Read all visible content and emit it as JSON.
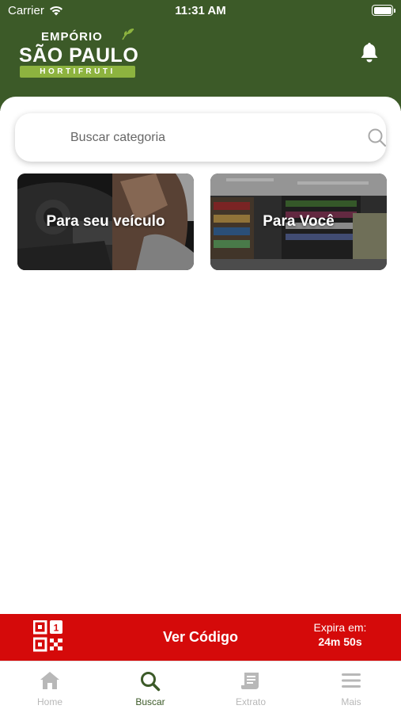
{
  "status_bar": {
    "carrier": "Carrier",
    "time": "11:31 AM"
  },
  "brand": {
    "line1": "EMPÓRIO",
    "line2": "SÃO PAULO",
    "line3": "HORTIFRUTI",
    "primary_color": "#3c5a28",
    "accent_color": "#8db33f"
  },
  "header": {
    "notification_icon": "bell-icon"
  },
  "search": {
    "placeholder": "Buscar categoria",
    "value": "",
    "icon": "search-icon"
  },
  "categories": [
    {
      "label": "Para seu veículo"
    },
    {
      "label": "Para Você"
    }
  ],
  "code_bar": {
    "label": "Ver Código",
    "expire_label": "Expira em:",
    "expire_value": "24m 50s",
    "icon": "qr-code-icon",
    "color": "#d50a0a"
  },
  "tabs": [
    {
      "label": "Home",
      "icon": "home-icon",
      "active": false
    },
    {
      "label": "Buscar",
      "icon": "search-icon",
      "active": true
    },
    {
      "label": "Extrato",
      "icon": "receipt-icon",
      "active": false
    },
    {
      "label": "Mais",
      "icon": "menu-icon",
      "active": false
    }
  ]
}
